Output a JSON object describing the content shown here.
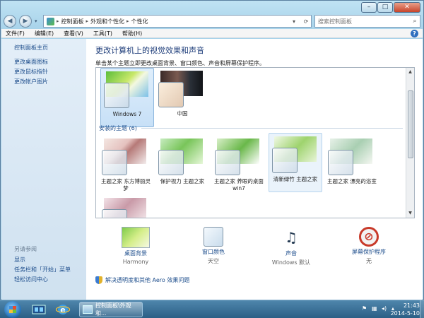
{
  "window": {
    "controls": {
      "minimize": "–",
      "maximize": "□",
      "close": "✕"
    }
  },
  "nav": {
    "breadcrumb": [
      "控制面板",
      "外观和个性化",
      "个性化"
    ],
    "search_placeholder": "搜索控制面板"
  },
  "menu": [
    "文件(F)",
    "编辑(E)",
    "查看(V)",
    "工具(T)",
    "帮助(H)"
  ],
  "sidebar": {
    "home": "控制面板主页",
    "links": [
      "更改桌面图标",
      "更改鼠标指针",
      "更改帐户图片"
    ],
    "see_also_title": "另请参阅",
    "see_also": [
      "显示",
      "任务栏和「开始」菜单",
      "轻松访问中心"
    ]
  },
  "main": {
    "title": "更改计算机上的视觉效果和声音",
    "subtitle": "单击某个主题立即更改桌面背景、窗口颜色、声音和屏幕保护程序。",
    "installed_header": "安装的主题 (6)",
    "themes_top": [
      {
        "label": "Windows 7",
        "selected": true
      },
      {
        "label": "中国",
        "selected": false
      }
    ],
    "themes_installed": [
      {
        "label": "主题之家 东方博丽灵梦"
      },
      {
        "label": "保护视力 主题之家"
      },
      {
        "label": "主题之家 养眼的桌面win7"
      },
      {
        "label": "清新绿竹 主题之家",
        "hovered": true
      },
      {
        "label": "主题之家 漂亮的浴室"
      }
    ],
    "bottom_items": [
      {
        "title": "桌面背景",
        "value": "Harmony",
        "icon": "wallpaper-icon"
      },
      {
        "title": "窗口颜色",
        "value": "天空",
        "icon": "window-color-icon"
      },
      {
        "title": "声音",
        "value": "Windows 默认",
        "icon": "sound-icon"
      },
      {
        "title": "屏幕保护程序",
        "value": "无",
        "icon": "screensaver-icon"
      }
    ],
    "fix_link": "解决透明度和其他 Aero 效果问题"
  },
  "taskbar": {
    "task_label": "控制面板\\外观和...",
    "time": "21:43",
    "date": "2014-5-10"
  }
}
